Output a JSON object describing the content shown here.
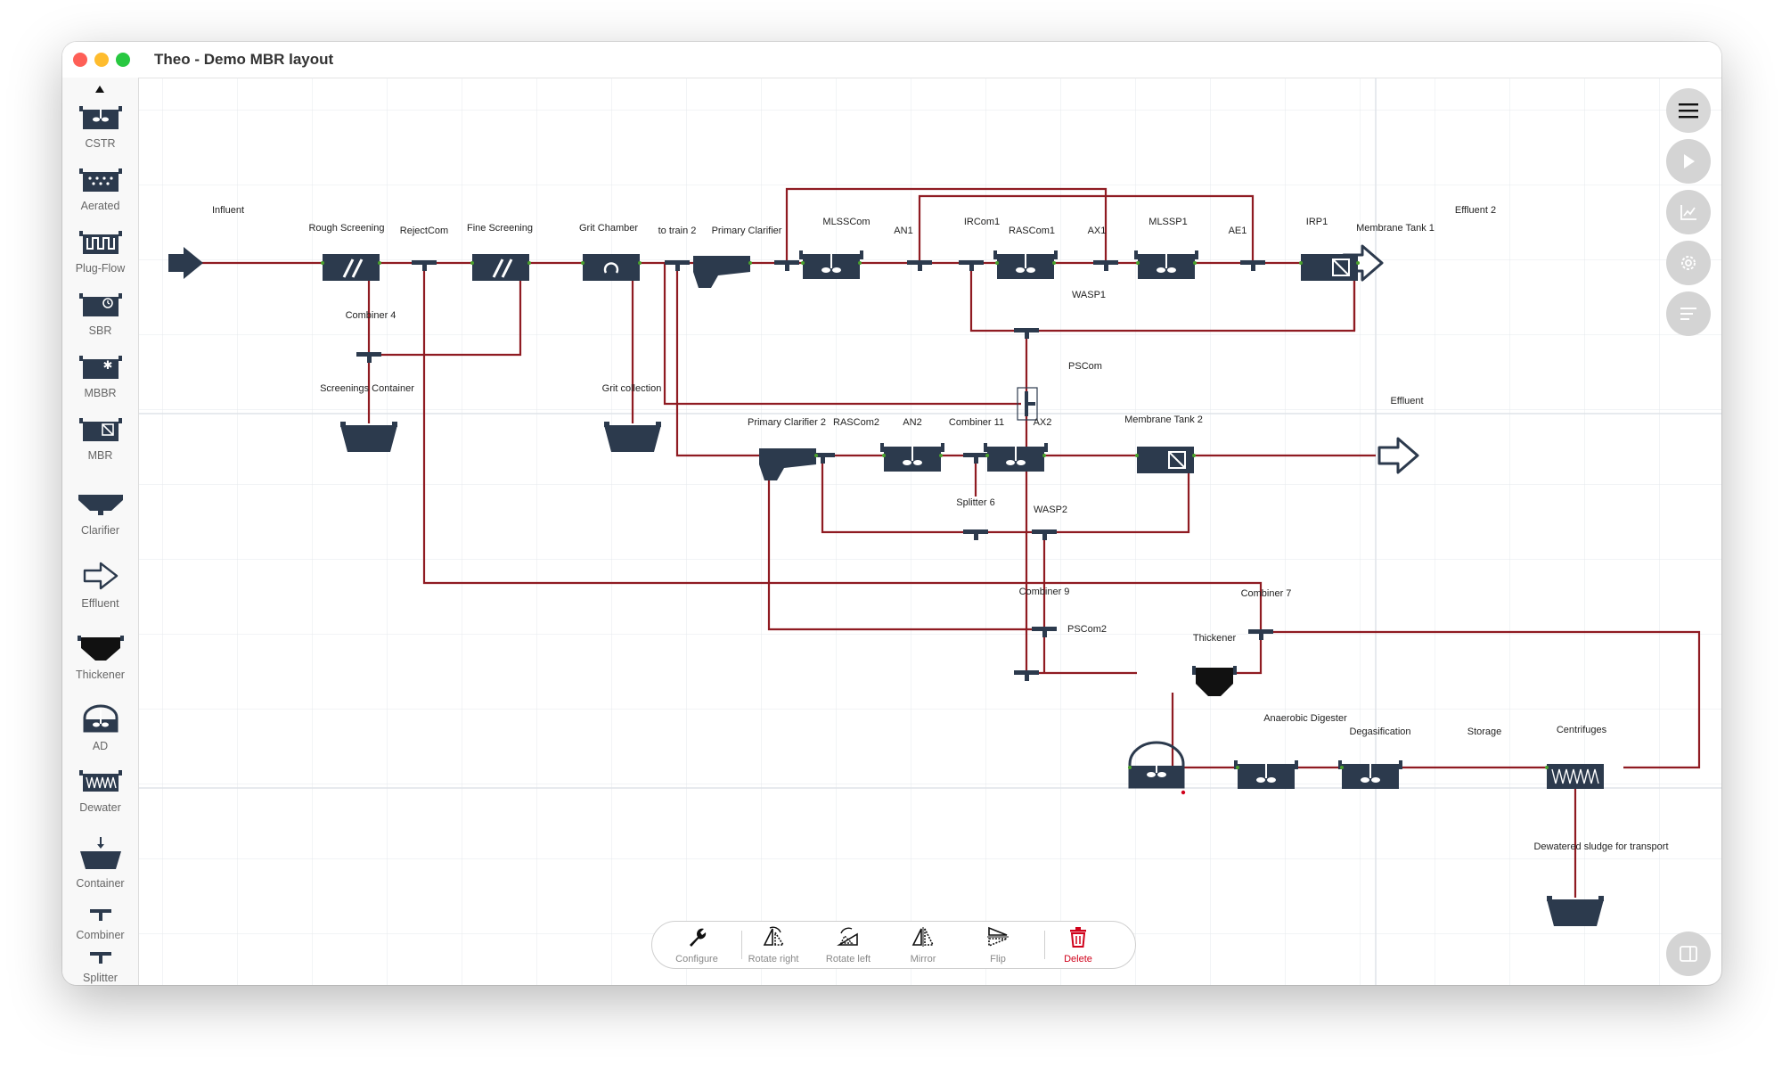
{
  "window": {
    "title": "Theo - Demo MBR layout"
  },
  "palette": {
    "items": [
      {
        "label": "CSTR",
        "icon": "cstr-tank-icon"
      },
      {
        "label": "Aerated",
        "icon": "aerated-tank-icon"
      },
      {
        "label": "Plug-Flow",
        "icon": "plug-flow-icon"
      },
      {
        "label": "SBR",
        "icon": "sbr-icon"
      },
      {
        "label": "MBBR",
        "icon": "mbbr-icon"
      },
      {
        "label": "MBR",
        "icon": "mbr-icon"
      },
      {
        "label": "Clarifier",
        "icon": "clarifier-icon"
      },
      {
        "label": "Effluent",
        "icon": "effluent-arrow-icon"
      },
      {
        "label": "Thickener",
        "icon": "thickener-icon"
      },
      {
        "label": "AD",
        "icon": "anaerobic-digester-icon"
      },
      {
        "label": "Dewater",
        "icon": "dewater-icon"
      },
      {
        "label": "Container",
        "icon": "container-icon"
      },
      {
        "label": "Combiner",
        "icon": "combiner-icon"
      },
      {
        "label": "Splitter",
        "icon": "splitter-icon"
      }
    ]
  },
  "diagram": {
    "labels": [
      "Influent",
      "Rough Screening",
      "RejectCom",
      "Fine Screening",
      "Grit Chamber",
      "to train 2",
      "Primary Clarifier",
      "MLSSCom",
      "AN1",
      "IRCom1",
      "RASCom1",
      "AX1",
      "MLSSP1",
      "AE1",
      "IRP1",
      "Membrane Tank 1",
      "Effluent 2",
      "WASP1",
      "Combiner 4",
      "Screenings Container",
      "Grit collection",
      "PSCom",
      "Effluent",
      "Primary Clarifier 2",
      "RASCom2",
      "AN2",
      "Combiner 11",
      "AX2",
      "Membrane Tank 2",
      "Splitter 6",
      "WASP2",
      "Combiner 9",
      "Combiner 7",
      "PSCom2",
      "Thickener",
      "Anaerobic Digester",
      "Degasification",
      "Storage",
      "Centrifuges",
      "Dewatered sludge for transport"
    ]
  },
  "toolbar": {
    "configure": "Configure",
    "rotate_right": "Rotate right",
    "rotate_left": "Rotate left",
    "mirror": "Mirror",
    "flip": "Flip",
    "delete": "Delete"
  },
  "colors": {
    "pipe": "#8f1b22",
    "unit": "#2c3a4d",
    "delete": "#d0021b",
    "grid": "#e6e8ec"
  }
}
